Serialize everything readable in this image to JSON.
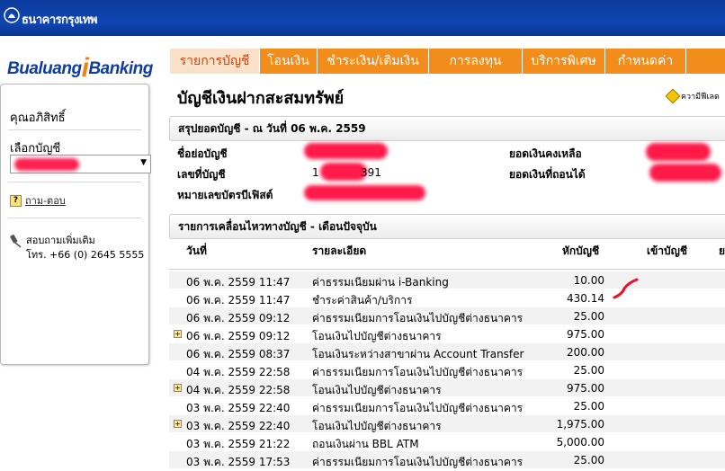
{
  "header": {
    "bank_name": "ธนาคารกรุงเทพ",
    "brand_prefix": "Bualuang",
    "brand_i": "i",
    "brand_suffix": "Banking"
  },
  "nav": {
    "tabs": [
      {
        "label": "รายการบัญชี",
        "active": true
      },
      {
        "label": "โอนเงิน",
        "active": false
      },
      {
        "label": "ชำระเงิน/เติมเงิน",
        "active": false
      },
      {
        "label": "การลงทุน",
        "active": false
      },
      {
        "label": "บริการพิเศษ",
        "active": false
      },
      {
        "label": "กำหนดค่า",
        "active": false
      }
    ]
  },
  "sidebar": {
    "privilege": "คุณอภิสิทธิ์",
    "select_account_label": "เลือกบัญชี",
    "faq": "ถาม-ตอบ",
    "contact_title": "สอบถามเพิ่มเติม",
    "contact_phone": "โทร. +66 (0) 2645 5555"
  },
  "page": {
    "title": "บัญชีเงินฝากสะสมทรัพย์",
    "help": "ความีฟีเลด"
  },
  "summary": {
    "heading": "สรุปยอดบัญชี - ณ วันที่ 06 พ.ค. 2559",
    "account_name_label": "ชื่อย่อบัญชี",
    "account_number_label": "เลขที่บัญชี",
    "account_number_prefix": "1",
    "account_number_suffix": "391",
    "debit_card_label": "หมายเลขบัตรบีเฟิสต์",
    "balance_label": "ยอดเงินคงเหลือ",
    "available_label": "ยอดเงินที่ถอนได้"
  },
  "transactions": {
    "heading": "รายการเคลื่อนไหวทางบัญชี - เดือนปัจจุบัน",
    "columns": {
      "date": "วันที่",
      "description": "รายละเอียด",
      "debit": "หักบัญชี",
      "credit": "เข้าบัญชี",
      "extra": "ย"
    },
    "rows": [
      {
        "expand": false,
        "date": "06 พ.ค. 2559 11:47",
        "description": "ค่าธรรมเนียมผ่าน i-Banking",
        "debit": "10.00"
      },
      {
        "expand": false,
        "date": "06 พ.ค. 2559 11:47",
        "description": "ชำระค่าสินค้า/บริการ",
        "debit": "430.14"
      },
      {
        "expand": false,
        "date": "06 พ.ค. 2559 09:12",
        "description": "ค่าธรรมเนียมการโอนเงินไปบัญชีต่างธนาคาร",
        "debit": "25.00"
      },
      {
        "expand": true,
        "date": "06 พ.ค. 2559 09:12",
        "description": "โอนเงินไปบัญชีต่างธนาคาร",
        "debit": "975.00"
      },
      {
        "expand": false,
        "date": "06 พ.ค. 2559 08:37",
        "description": "โอนเงินระหว่างสาขาผ่าน Account Transfer",
        "debit": "200.00"
      },
      {
        "expand": false,
        "date": "04 พ.ค. 2559 22:58",
        "description": "ค่าธรรมเนียมการโอนเงินไปบัญชีต่างธนาคาร",
        "debit": "25.00"
      },
      {
        "expand": true,
        "date": "04 พ.ค. 2559 22:58",
        "description": "โอนเงินไปบัญชีต่างธนาคาร",
        "debit": "975.00"
      },
      {
        "expand": false,
        "date": "03 พ.ค. 2559 22:40",
        "description": "ค่าธรรมเนียมการโอนเงินไปบัญชีต่างธนาคาร",
        "debit": "25.00"
      },
      {
        "expand": true,
        "date": "03 พ.ค. 2559 22:40",
        "description": "โอนเงินไปบัญชีต่างธนาคาร",
        "debit": "1,975.00"
      },
      {
        "expand": false,
        "date": "03 พ.ค. 2559 21:22",
        "description": "ถอนเงินผ่าน BBL ATM",
        "debit": "5,000.00"
      },
      {
        "expand": false,
        "date": "03 พ.ค. 2559 17:53",
        "description": "ค่าธรรมเนียมการโอนเงินไปบัญชีต่างธนาคาร",
        "debit": "25.00"
      }
    ]
  },
  "colors": {
    "nav_orange": "#f28c1a",
    "nav_active_bg": "#fbe1c7",
    "top_blue": "#1046b4",
    "redaction": "#ff1a4a"
  }
}
